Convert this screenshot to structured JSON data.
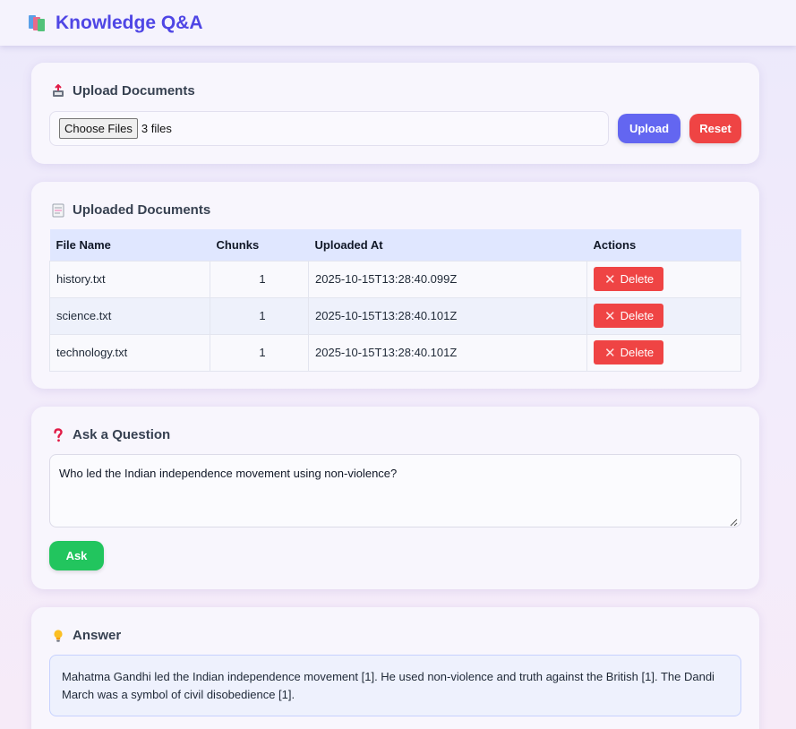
{
  "app": {
    "title": "Knowledge Q&A",
    "logo_icon": "books-icon"
  },
  "upload": {
    "title": "Upload Documents",
    "icon": "inbox-tray-icon",
    "choose_label": "Choose Files",
    "files_selected": "3 files",
    "upload_label": "Upload",
    "reset_label": "Reset"
  },
  "documents": {
    "title": "Uploaded Documents",
    "icon": "document-icon",
    "columns": [
      "File Name",
      "Chunks",
      "Uploaded At",
      "Actions"
    ],
    "rows": [
      {
        "file_name": "history.txt",
        "chunks": "1",
        "uploaded_at": "2025-10-15T13:28:40.099Z",
        "action": "Delete"
      },
      {
        "file_name": "science.txt",
        "chunks": "1",
        "uploaded_at": "2025-10-15T13:28:40.101Z",
        "action": "Delete"
      },
      {
        "file_name": "technology.txt",
        "chunks": "1",
        "uploaded_at": "2025-10-15T13:28:40.101Z",
        "action": "Delete"
      }
    ]
  },
  "ask": {
    "title": "Ask a Question",
    "icon": "question-mark-icon",
    "question": "Who led the Indian independence movement using non-violence?",
    "ask_label": "Ask"
  },
  "answer": {
    "title": "Answer",
    "icon": "lightbulb-icon",
    "text": "Mahatma Gandhi led the Indian independence movement [1]. He used non-violence and truth against the British [1]. The Dandi March was a symbol of civil disobedience [1]."
  },
  "colors": {
    "accent": "#4f46e5",
    "upload": "#6366f1",
    "danger": "#ef4444",
    "success": "#22c55e"
  }
}
